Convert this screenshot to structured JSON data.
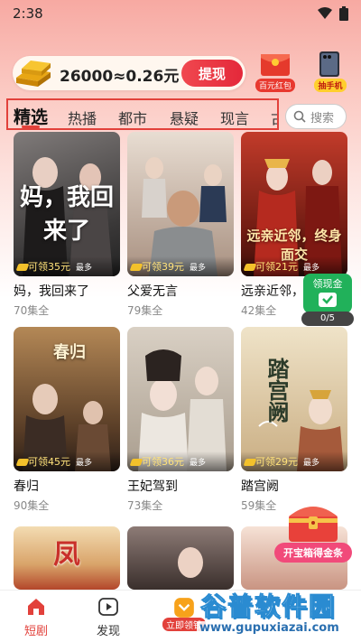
{
  "status_bar": {
    "time": "2:38"
  },
  "coins": {
    "text": "26000≈0.26元",
    "withdraw_label": "提现"
  },
  "promos": [
    {
      "label": "百元红包",
      "icon": "red-envelope-icon"
    },
    {
      "label": "抽手机",
      "icon": "phone-prize-icon"
    }
  ],
  "tabs": [
    "精选",
    "热播",
    "都市",
    "悬疑",
    "现言",
    "古"
  ],
  "search": {
    "placeholder": "搜索"
  },
  "dramas": [
    {
      "poster_title": "妈，我回来了",
      "reward": "可领35元",
      "max": "最多",
      "title": "妈，我回来了",
      "episodes": "70集全",
      "colors": [
        "#6d6a6a",
        "#2f2d2e"
      ]
    },
    {
      "poster_title": "",
      "reward": "可领39元",
      "max": "最多",
      "title": "父爱无言",
      "episodes": "79集全",
      "colors": [
        "#d8c6b8",
        "#7c6a5f"
      ]
    },
    {
      "poster_title": "远亲近邻，终身面交",
      "reward": "可领21元",
      "max": "最多",
      "title": "远亲近邻，终身面交",
      "episodes": "42集全",
      "colors": [
        "#b43327",
        "#3b1610"
      ]
    },
    {
      "poster_title": "春归",
      "reward": "可领45元",
      "max": "最多",
      "title": "春归",
      "episodes": "90集全",
      "colors": [
        "#a8794b",
        "#3e2b1e"
      ]
    },
    {
      "poster_title": "",
      "reward": "可领36元",
      "max": "最多",
      "title": "王妃驾到",
      "episodes": "73集全",
      "colors": [
        "#dcd4c8",
        "#8e8173"
      ]
    },
    {
      "poster_title": "踏宫阙",
      "reward": "可领29元",
      "max": "最多",
      "title": "踏宫阙",
      "episodes": "59集全",
      "colors": [
        "#ebdcc0",
        "#b9976c"
      ]
    },
    {
      "poster_title": "凤",
      "colors": [
        "#f0d9b0",
        "#c64a2b"
      ]
    },
    {
      "poster_title": "",
      "colors": [
        "#7a6a66",
        "#2e2422"
      ]
    },
    {
      "poster_title": "",
      "colors": [
        "#f2d9c8",
        "#b78371"
      ]
    }
  ],
  "float_reward": {
    "title": "领现金",
    "progress": "0/5"
  },
  "treasure": {
    "label": "开宝箱得金条"
  },
  "bottom_nav": [
    {
      "label": "短剧",
      "icon": "home-icon",
      "active": true
    },
    {
      "label": "发现",
      "icon": "play-icon",
      "active": false
    },
    {
      "label": "立即领钱",
      "icon": "coin-bag-icon",
      "active": false
    }
  ],
  "watermark": {
    "big": "谷普软件园",
    "small": "www.gupuxiazai.com"
  },
  "colors": {
    "accent": "#e2413b",
    "green": "#21b15a",
    "gold": "#f3c12b"
  }
}
